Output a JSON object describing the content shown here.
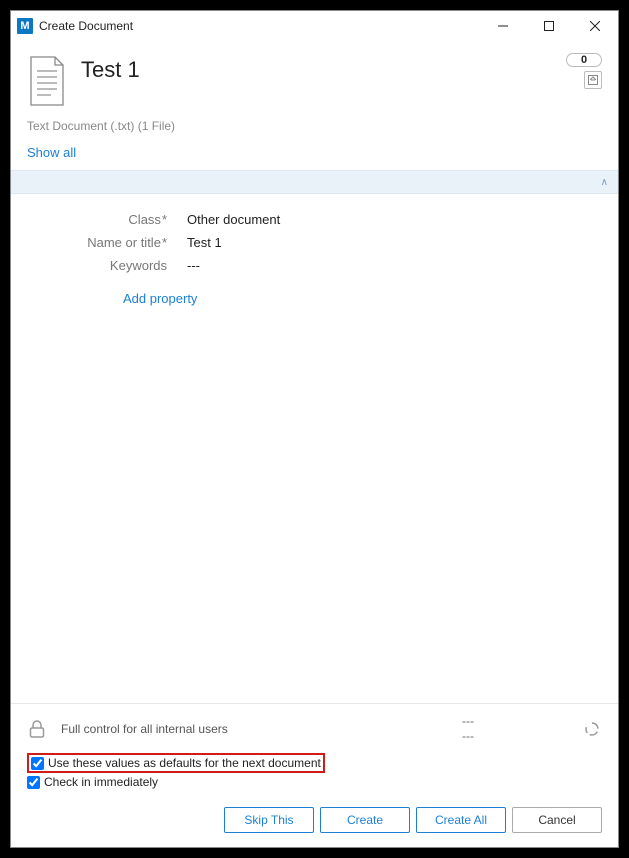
{
  "window": {
    "app_icon_letter": "M",
    "title": "Create Document",
    "badge_count": "0"
  },
  "header": {
    "doc_title": "Test 1",
    "subtitle": "Text Document (.txt) (1 File)",
    "show_all": "Show all"
  },
  "properties": {
    "rows": [
      {
        "label": "Class",
        "required": true,
        "value": "Other document"
      },
      {
        "label": "Name or title",
        "required": true,
        "value": "Test 1"
      },
      {
        "label": "Keywords",
        "required": false,
        "value": "---"
      }
    ],
    "add_property": "Add property"
  },
  "permissions": {
    "text": "Full control for all internal users",
    "col1": "---",
    "col2": "---"
  },
  "options": {
    "use_defaults": {
      "label": "Use these values as defaults for the next document",
      "checked": true
    },
    "check_in": {
      "label": "Check in immediately",
      "checked": true
    }
  },
  "buttons": {
    "skip": "Skip This",
    "create": "Create",
    "create_all": "Create All",
    "cancel": "Cancel"
  }
}
